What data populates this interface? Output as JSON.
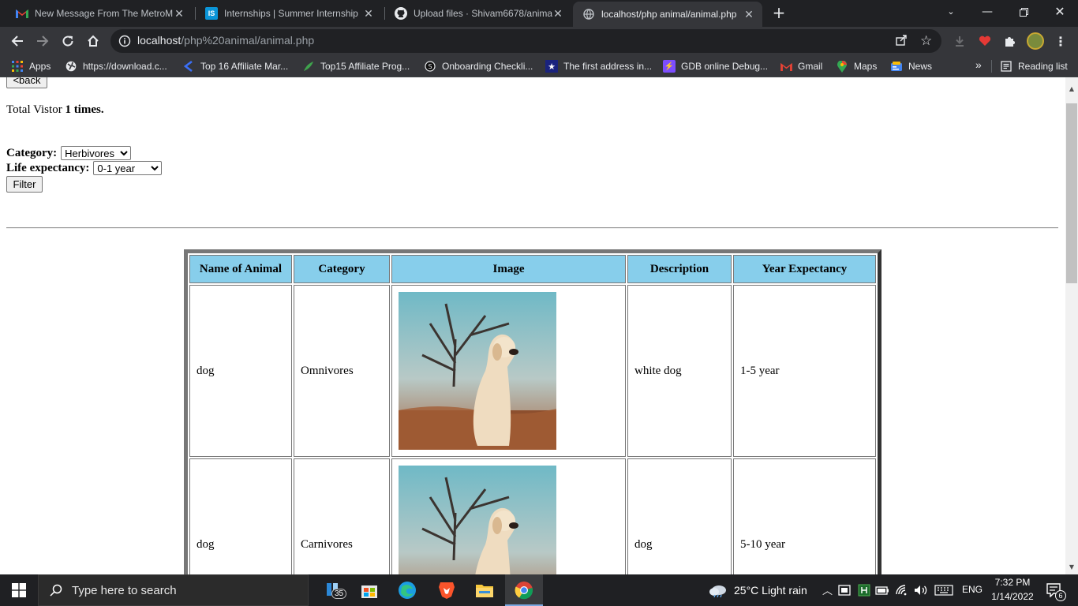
{
  "browser": {
    "tabs": [
      {
        "title": "New Message From The MetroM",
        "favicon": "gmail-icon",
        "active": false
      },
      {
        "title": "Internships | Summer Internship",
        "favicon": "internshala-icon",
        "active": false
      },
      {
        "title": "Upload files · Shivam6678/animal",
        "favicon": "github-icon",
        "active": false
      },
      {
        "title": "localhost/php animal/animal.php",
        "favicon": "globe-icon",
        "active": true
      }
    ],
    "url": {
      "host": "localhost",
      "path": "/php%20animal/animal.php"
    },
    "bookmarks": [
      {
        "label": "Apps",
        "icon": "apps-grid-icon"
      },
      {
        "label": "https://download.c...",
        "icon": "globe-icon"
      },
      {
        "label": "Top 16 Affiliate Mar...",
        "icon": "bookmark-icon"
      },
      {
        "label": "Top15 Affiliate Prog...",
        "icon": "leaf-icon"
      },
      {
        "label": "Onboarding Checkli...",
        "icon": "circle-icon"
      },
      {
        "label": "The first address in...",
        "icon": "star-icon"
      },
      {
        "label": "GDB online Debug...",
        "icon": "bolt-icon"
      },
      {
        "label": "Gmail",
        "icon": "gmail-icon"
      },
      {
        "label": "Maps",
        "icon": "maps-pin-icon"
      },
      {
        "label": "News",
        "icon": "news-icon"
      }
    ],
    "bookmarks_overflow": "»",
    "reading_list": "Reading list"
  },
  "page": {
    "back_label": "<back",
    "visitor_prefix": "Total Vistor ",
    "visitor_count": "1 times.",
    "category_label": "Category:",
    "category_selected": "Herbivores",
    "life_label": "Life expectancy:",
    "life_selected": "0-1 year",
    "filter_label": "Filter",
    "table": {
      "headers": [
        "Name of Animal",
        "Category",
        "Image",
        "Description",
        "Year Expectancy"
      ],
      "rows": [
        {
          "name": "dog",
          "category": "Omnivores",
          "description": "white dog",
          "years": "1-5 year"
        },
        {
          "name": "dog",
          "category": "Carnivores",
          "description": "dog",
          "years": "5-10 year"
        }
      ]
    }
  },
  "taskbar": {
    "search_placeholder": "Type here to search",
    "badge_count": "35",
    "weather": "25°C  Light rain",
    "language": "ENG",
    "time": "7:32 PM",
    "date": "1/14/2022",
    "notifications": "6"
  },
  "colors": {
    "header_bg": "#87ceeb",
    "chrome_dark": "#202124",
    "chrome_toolbar": "#35363a"
  }
}
